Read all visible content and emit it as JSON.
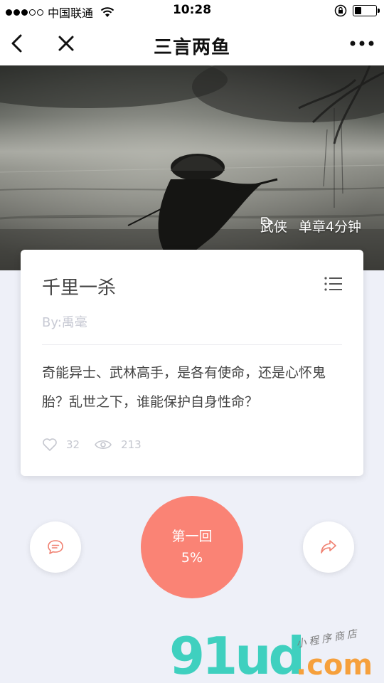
{
  "status_bar": {
    "carrier": "中国联通",
    "time": "10:28",
    "signal_bars_filled": 3,
    "signal_bars_total": 5,
    "battery_level": 0.35,
    "icons": [
      "wifi-icon",
      "rotation-lock-icon",
      "battery-icon"
    ]
  },
  "nav": {
    "title": "三言两鱼",
    "back_icon": "chevron-left-icon",
    "close_icon": "close-icon",
    "more_icon": "more-icon"
  },
  "hero": {
    "tag_icon": "tag-icon",
    "genre": "武侠",
    "duration": "单章4分钟"
  },
  "story": {
    "title": "千里一杀",
    "author": "By:禹毫",
    "description": "奇能异士、武林高手，是各有使命，还是心怀鬼胎？乱世之下，谁能保护自身性命？",
    "likes": "32",
    "views": "213",
    "menu_icon": "list-icon"
  },
  "actions": {
    "chapter": "第一回",
    "progress": "5%",
    "progress_value": 0.05,
    "comment_icon": "comment-icon",
    "share_icon": "share-icon"
  },
  "watermark": {
    "main": "91ud",
    "domain": ".com",
    "subtitle": "小程序商店"
  },
  "colors": {
    "accent": "#fa8375",
    "background": "#eef0f8",
    "watermark_green": "#3fd0bf",
    "watermark_orange": "#f6a03c"
  }
}
